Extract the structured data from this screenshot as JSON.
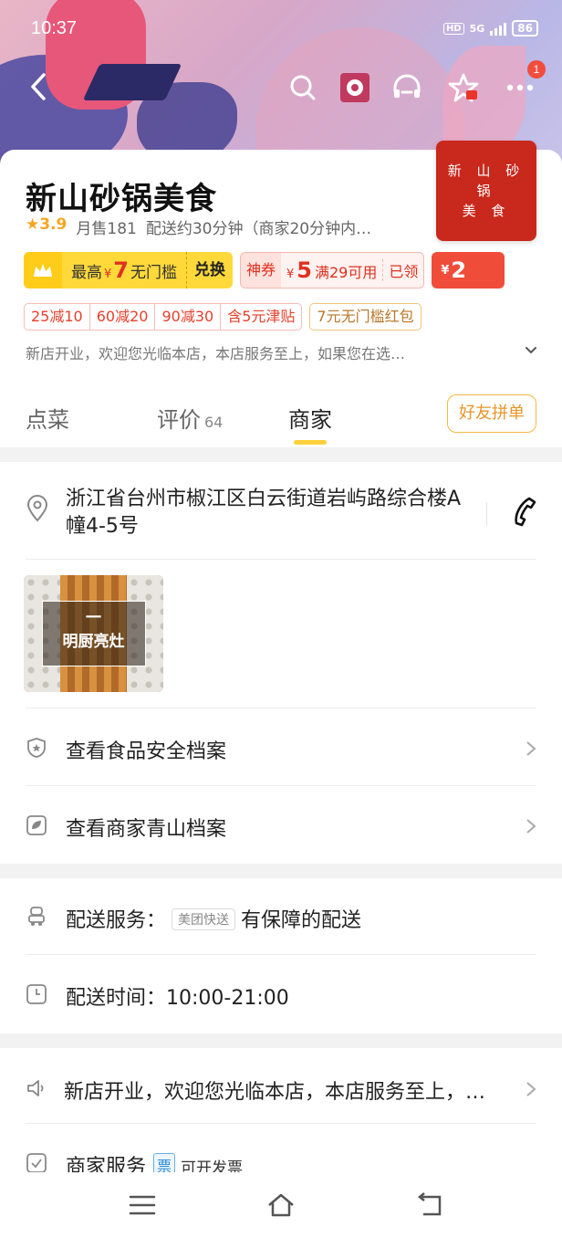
{
  "status_bar": {
    "time": "10:37",
    "hd": "HD",
    "network": "5G",
    "battery": "86"
  },
  "header": {
    "notification_count": "1"
  },
  "store": {
    "name": "新山砂锅美食",
    "logo_lines": [
      "新 山 砂 锅",
      "美 食"
    ],
    "rating": "3.9",
    "monthly_sales": "月售181",
    "delivery": "配送约30分钟（商家20分钟内…"
  },
  "coupons": {
    "gold": {
      "prefix": "最高",
      "yen": "¥",
      "amount": "7",
      "suffix": "无门槛",
      "action": "兑换"
    },
    "red": {
      "tag": "神券",
      "yen": "¥",
      "amount": "5",
      "condition": "满29可用",
      "action": "已领"
    },
    "solid": {
      "yen": "¥",
      "amount": "2"
    }
  },
  "promo_tags": [
    "25减10",
    "60减20",
    "90减30",
    "含5元津贴"
  ],
  "gold_tag": "7元无门槛红包",
  "notice": "新店开业，欢迎您光临本店，本店服务至上，如果您在选…",
  "tabs": [
    {
      "label": "点菜",
      "count": ""
    },
    {
      "label": "评价",
      "count": "64"
    },
    {
      "label": "商家",
      "count": ""
    }
  ],
  "group_button": "好友拼单",
  "merchant": {
    "address": "浙江省台州市椒江区白云街道岩屿路综合楼A幢4-5号",
    "photo_caption_line1": "一",
    "photo_caption_line2": "明厨亮灶",
    "food_safety": "查看食品安全档案",
    "qingshan": "查看商家青山档案",
    "delivery_service_label": "配送服务：",
    "delivery_service_pill": "美团快送",
    "delivery_service_value": "有保障的配送",
    "delivery_time": "配送时间：10:00-21:00",
    "announcement": "新店开业，欢迎您光临本店，本店服务至上，…",
    "merchant_service_label": "商家服务",
    "invoice_pill": "票",
    "invoice_text": "可开发票"
  },
  "colors": {
    "accent_yellow": "#ffd03a",
    "coupon_red": "#e0301e",
    "logo_red": "#c9281c"
  }
}
